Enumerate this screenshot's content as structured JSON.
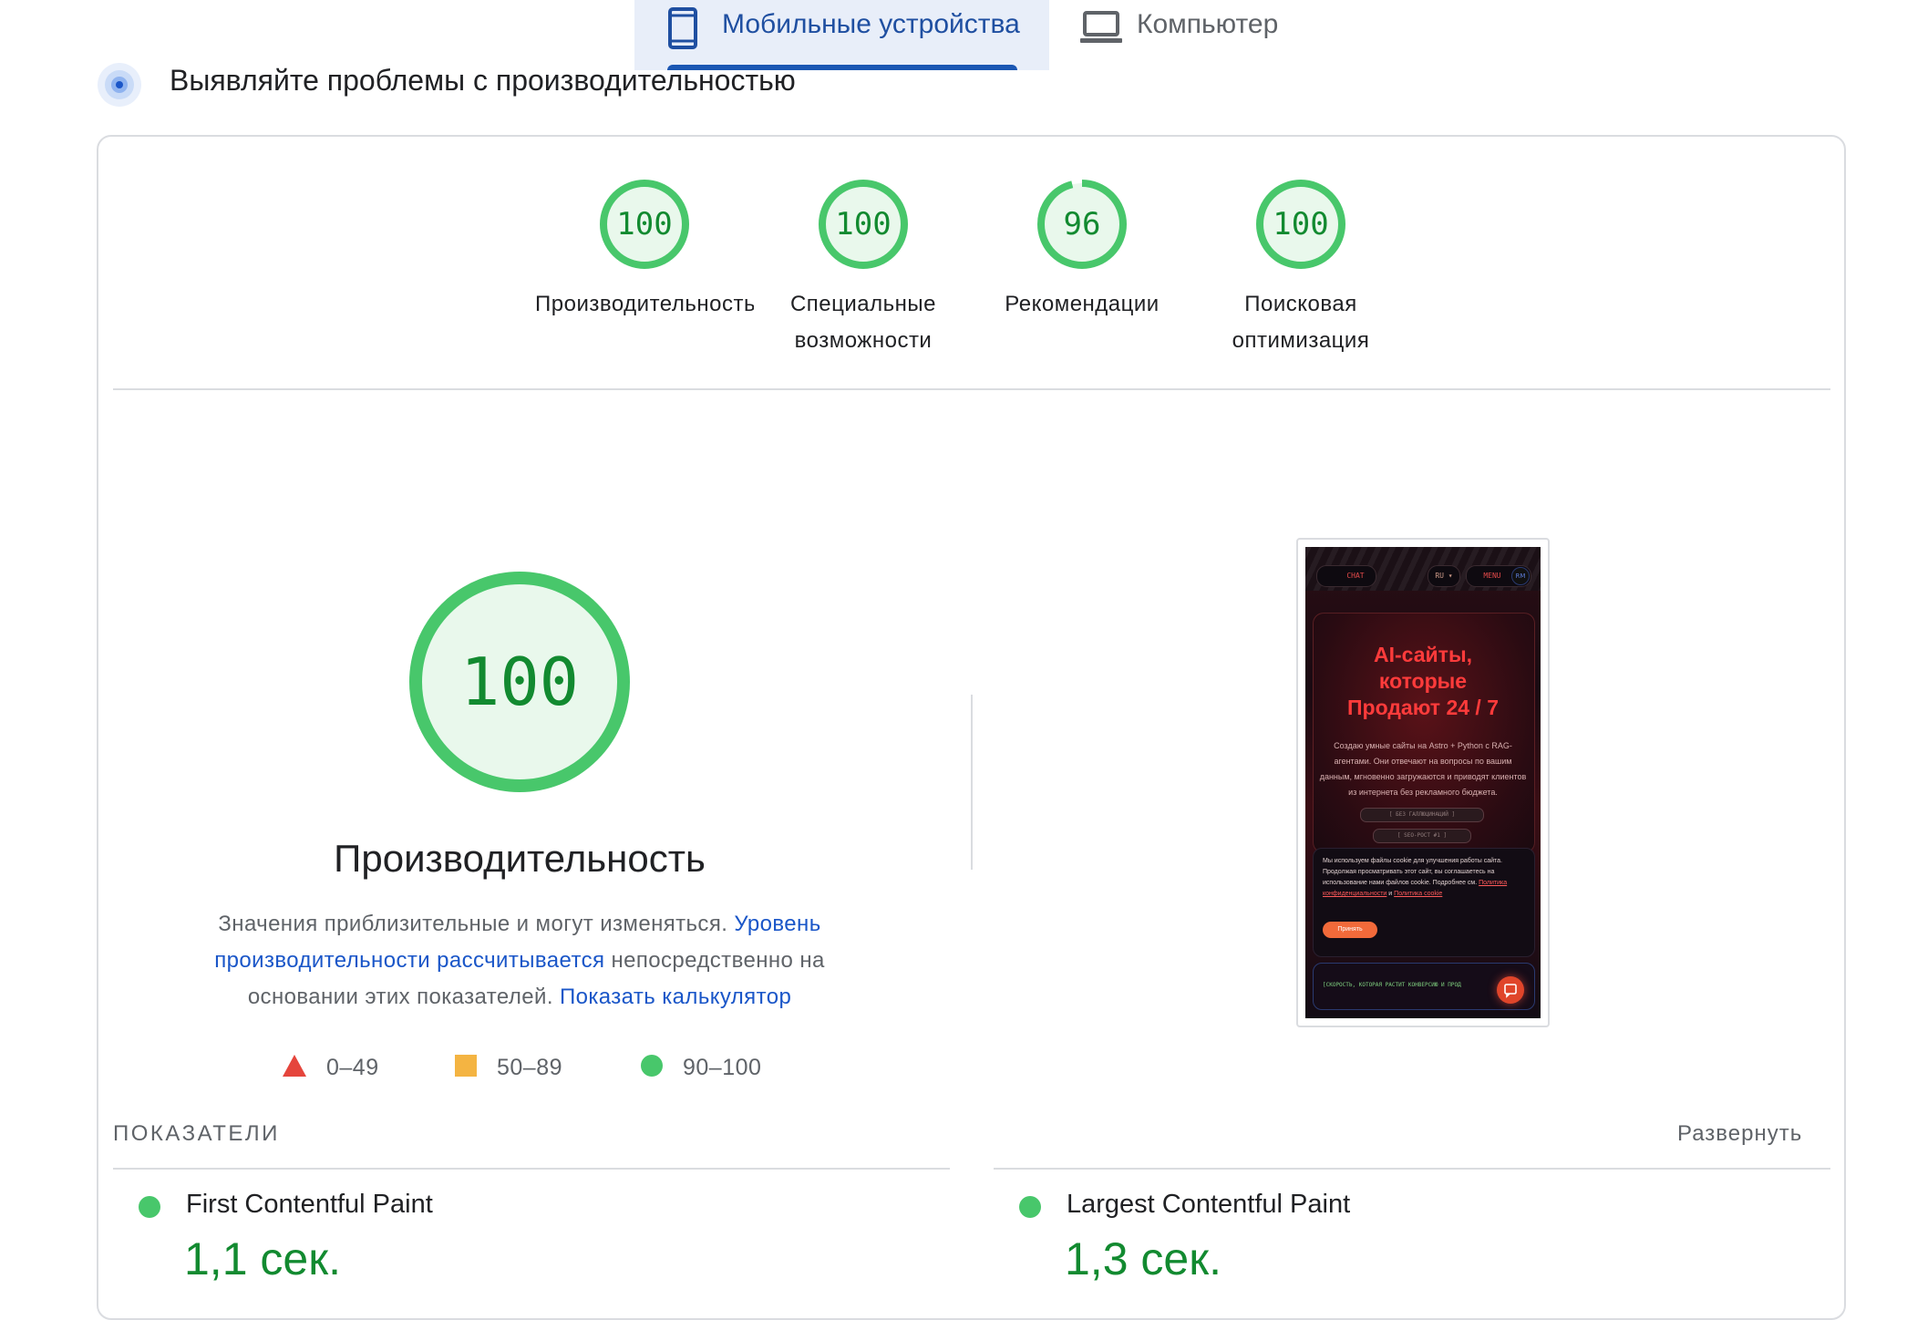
{
  "tabs": {
    "mobile": {
      "label": "Мобильные устройства",
      "icon": "smartphone-icon"
    },
    "desktop": {
      "label": "Компьютер",
      "icon": "laptop-icon"
    }
  },
  "section": {
    "title": "Выявляйте проблемы с производительностью",
    "icon": "performance-target-icon"
  },
  "categories": [
    {
      "score": "100",
      "label_line1": "Производительность",
      "label_line2": ""
    },
    {
      "score": "100",
      "label_line1": "Специальные",
      "label_line2": "возможности"
    },
    {
      "score": "96",
      "label_line1": "Рекомендации",
      "label_line2": ""
    },
    {
      "score": "100",
      "label_line1": "Поисковая",
      "label_line2": "оптимизация"
    }
  ],
  "main": {
    "score": "100",
    "title": "Производительность",
    "desc_text1": "Значения приблизительные и могут изменяться. ",
    "desc_link1": "Уровень производительности рассчитывается",
    "desc_text2": " непосредственно на основании этих показателей. ",
    "desc_link2": "Показать калькулятор"
  },
  "legend": [
    {
      "range": "0–49",
      "shape": "triangle",
      "color": "#e5453c"
    },
    {
      "range": "50–89",
      "shape": "square",
      "color": "#f4b442"
    },
    {
      "range": "90–100",
      "shape": "circle",
      "color": "#48c76b"
    }
  ],
  "preview": {
    "logo": "RM",
    "chat_label": "CHAT",
    "lang_label": "RU ▾",
    "menu_label": "MENU",
    "hero_title_line1": "AI-сайты,",
    "hero_title_line2": "которые",
    "hero_title_line3": "Продают 24 / 7",
    "hero_text": "Создаю умные сайты на Astro + Python с RAG-агентами. Они отвечают на вопросы по вашим данным, мгновенно загружаются и приводят клиентов из интернета без рекламного бюджета.",
    "tag1": "[ БЕЗ ГАЛЛЮЦИНАЦИЙ ]",
    "tag2": "[ SEO-РОСТ #1 ]",
    "cookie_text": "Мы используем файлы cookie для улучшения работы сайта. Продолжая просматривать этот сайт, вы соглашаетесь на использование нами файлов cookie. Подробнее см. ",
    "cookie_link1": "Политика конфиденциальности",
    "cookie_and": " и ",
    "cookie_link2": "Политика cookie",
    "cookie_button": "Принять",
    "bottom_text": "[СКОРОСТЬ, КОТОРАЯ РАСТИТ КОНВЕРСИЮ И ПРОД"
  },
  "metrics": {
    "title": "ПОКАЗАТЕЛИ",
    "expand_label": "Развернуть",
    "items": [
      {
        "name": "First Contentful Paint",
        "value": "1,1 сек.",
        "status_color": "#0cce6b"
      },
      {
        "name": "Largest Contentful Paint",
        "value": "1,3 сек.",
        "status_color": "#0cce6b"
      }
    ]
  },
  "colors": {
    "accent": "#1a56b3",
    "pass_green": "#0cce6b",
    "score_text_green": "#128a30",
    "gauge_fill": "#e9f8ec"
  }
}
